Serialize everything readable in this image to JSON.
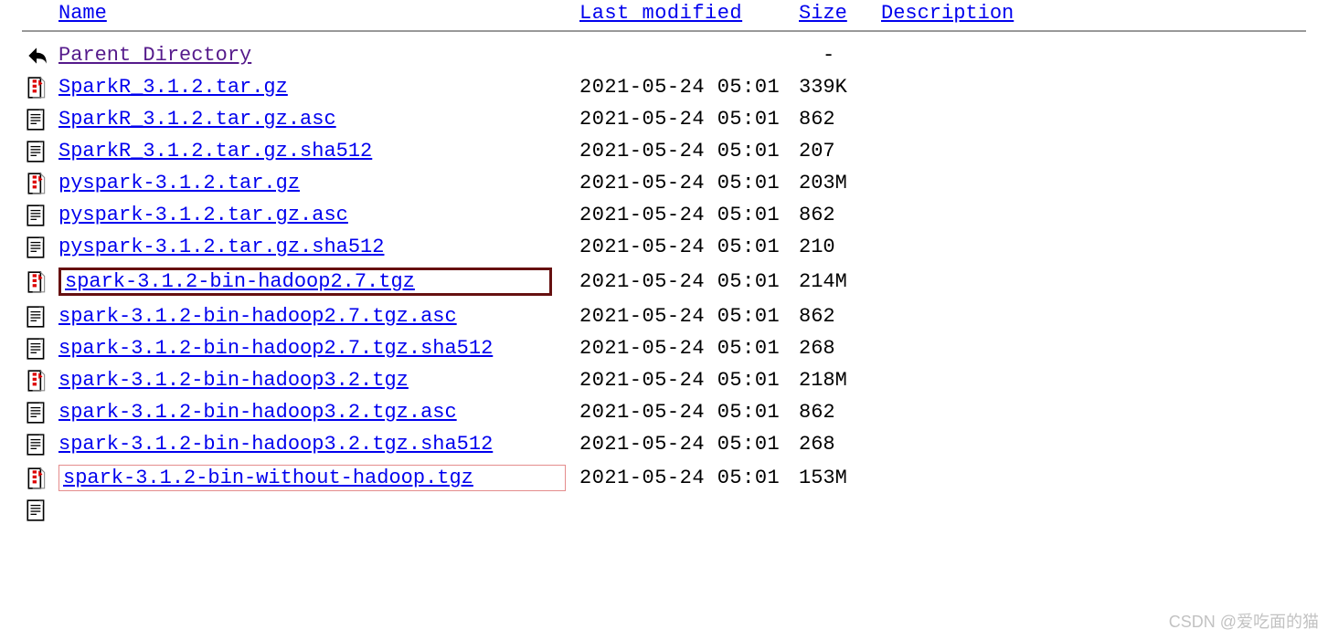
{
  "headers": {
    "name": "Name",
    "modified": "Last modified",
    "size": "Size",
    "description": "Description"
  },
  "parent": {
    "label": "Parent Directory",
    "size": "-"
  },
  "files": [
    {
      "icon": "archive",
      "name": "SparkR_3.1.2.tar.gz",
      "modified": "2021-05-24 05:01",
      "size": "339K",
      "highlight": "none"
    },
    {
      "icon": "text",
      "name": "SparkR_3.1.2.tar.gz.asc",
      "modified": "2021-05-24 05:01",
      "size": "862",
      "highlight": "none"
    },
    {
      "icon": "text",
      "name": "SparkR_3.1.2.tar.gz.sha512",
      "modified": "2021-05-24 05:01",
      "size": "207",
      "highlight": "none"
    },
    {
      "icon": "archive",
      "name": "pyspark-3.1.2.tar.gz",
      "modified": "2021-05-24 05:01",
      "size": "203M",
      "highlight": "none"
    },
    {
      "icon": "text",
      "name": "pyspark-3.1.2.tar.gz.asc",
      "modified": "2021-05-24 05:01",
      "size": "862",
      "highlight": "none"
    },
    {
      "icon": "text",
      "name": "pyspark-3.1.2.tar.gz.sha512",
      "modified": "2021-05-24 05:01",
      "size": "210",
      "highlight": "none"
    },
    {
      "icon": "archive",
      "name": "spark-3.1.2-bin-hadoop2.7.tgz",
      "modified": "2021-05-24 05:01",
      "size": "214M",
      "highlight": "dark"
    },
    {
      "icon": "text",
      "name": "spark-3.1.2-bin-hadoop2.7.tgz.asc",
      "modified": "2021-05-24 05:01",
      "size": "862",
      "highlight": "none"
    },
    {
      "icon": "text",
      "name": "spark-3.1.2-bin-hadoop2.7.tgz.sha512",
      "modified": "2021-05-24 05:01",
      "size": "268",
      "highlight": "none"
    },
    {
      "icon": "archive",
      "name": "spark-3.1.2-bin-hadoop3.2.tgz",
      "modified": "2021-05-24 05:01",
      "size": "218M",
      "highlight": "none"
    },
    {
      "icon": "text",
      "name": "spark-3.1.2-bin-hadoop3.2.tgz.asc",
      "modified": "2021-05-24 05:01",
      "size": "862",
      "highlight": "none"
    },
    {
      "icon": "text",
      "name": "spark-3.1.2-bin-hadoop3.2.tgz.sha512",
      "modified": "2021-05-24 05:01",
      "size": "268",
      "highlight": "none"
    },
    {
      "icon": "archive",
      "name": "spark-3.1.2-bin-without-hadoop.tgz",
      "modified": "2021-05-24 05:01",
      "size": "153M",
      "highlight": "light"
    }
  ],
  "watermark": "CSDN @爱吃面的猫"
}
